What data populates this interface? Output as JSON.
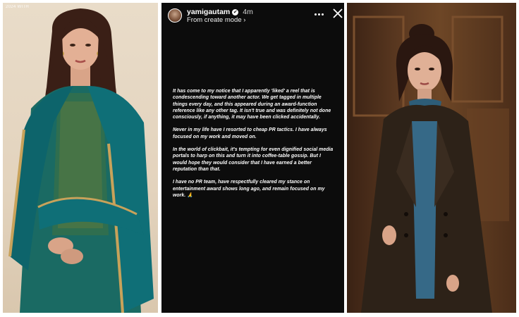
{
  "left_photo": {
    "credit": "2024 WITH"
  },
  "story": {
    "handle": "yamigautam",
    "time": "4m",
    "subline": "From create mode",
    "paragraphs": [
      "It has come to my notice that I apparently 'liked' a reel that is condescending toward another actor. We get tagged in multiple things every day, and this appeared during an award-function reference like any other tag. It isn't true and was definitely not done consciously, if anything, it may have been clicked accidentally.",
      "Never in my life have I resorted to cheap PR tactics. I have always focused on my work and moved on.",
      "In the world of clickbait, it's tempting for even dignified social media portals to harp on this and turn it into coffee-table gossip. But I would hope they would consider that I have earned a better reputation than that.",
      "I have no PR team, have respectfully cleared my stance on entertainment award shows long ago, and remain focused on my work. 🙏"
    ]
  },
  "icons": {
    "verified": "verified-badge-icon",
    "chevron": "chevron-right-icon",
    "more": "more-options-icon",
    "close": "close-icon"
  },
  "colors": {
    "story_background": "#0c0c0c",
    "teal_dress": "#0f6f77",
    "coat": "#2d2218"
  }
}
